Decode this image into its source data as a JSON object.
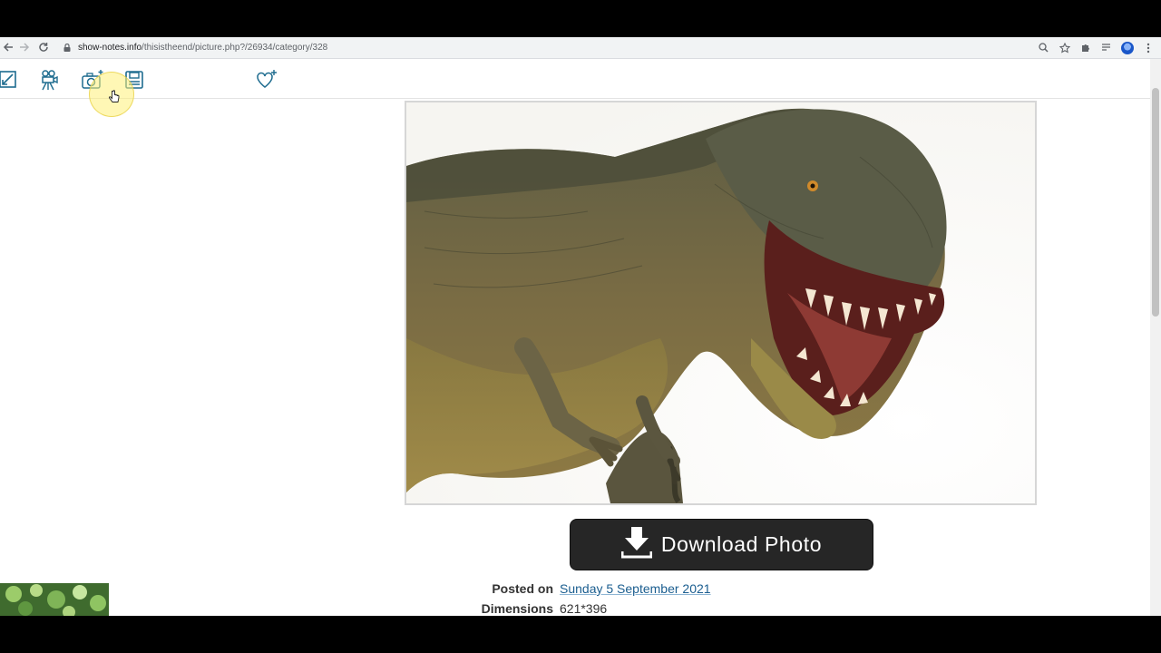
{
  "browser": {
    "url_host": "show-notes.info",
    "url_path": "/thisistheend/picture.php?/26934/category/328"
  },
  "page": {
    "download_label": "Download Photo",
    "meta": [
      {
        "label": "Posted on",
        "value": "Sunday 5 September 2021",
        "is_link": true
      },
      {
        "label": "Dimensions",
        "value": "621*396",
        "is_link": false
      }
    ]
  },
  "icons": {
    "toolbar": [
      "fullscreen-icon",
      "slideshow-icon",
      "camera-icon",
      "save-icon",
      "favorite-icon"
    ]
  },
  "colors": {
    "button": "#262626",
    "link": "#1a5d8f"
  }
}
